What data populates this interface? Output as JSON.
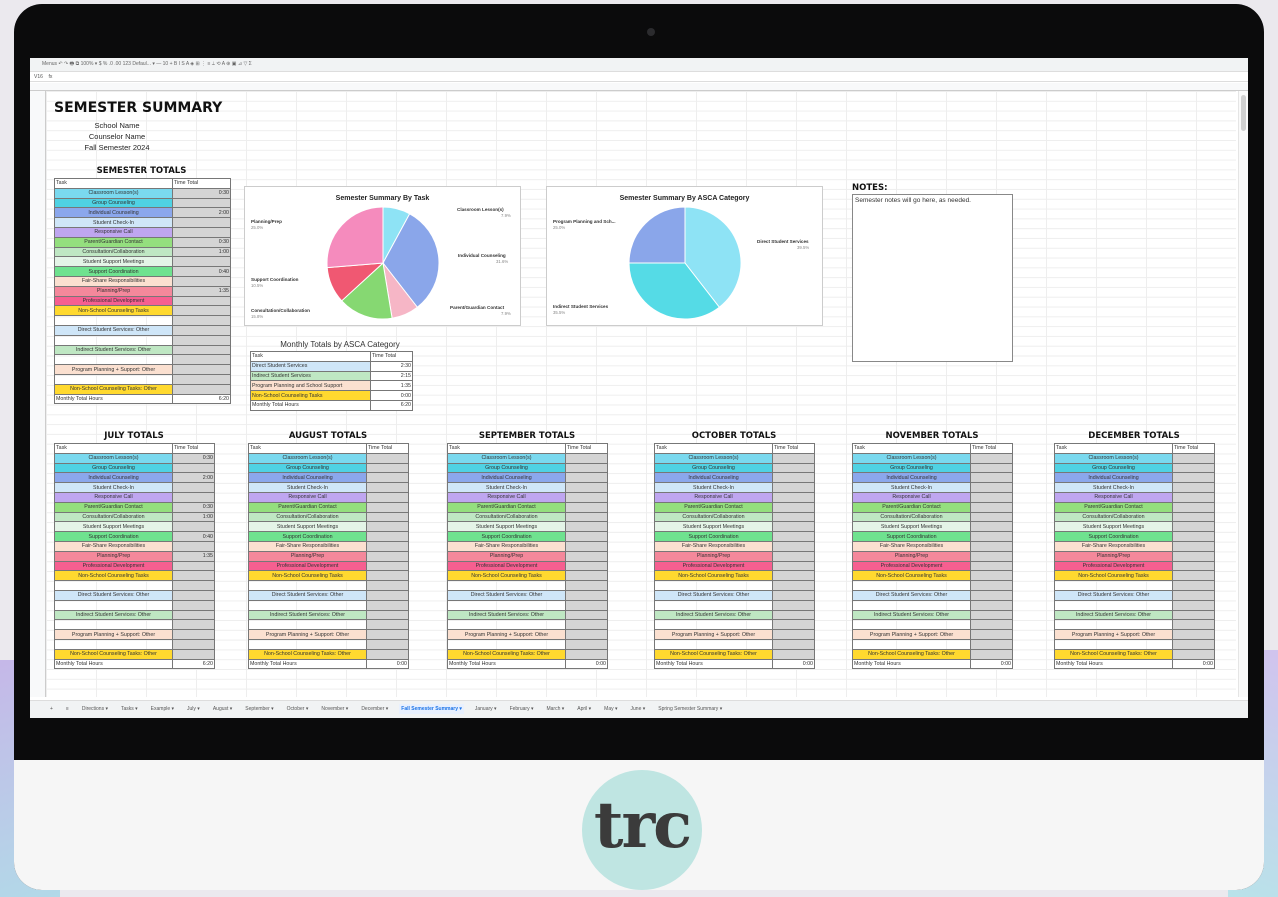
{
  "colors": {
    "cyan": "#7ad9ef",
    "teal": "#4fd2e3",
    "blue": "#8ba7ec",
    "light_blue": "#cfe6f8",
    "purple": "#bfa6f0",
    "green": "#94df7e",
    "light_green": "#bfe7c3",
    "mint": "#e4f4e7",
    "lime": "#6fe28f",
    "peach": "#fbe0d0",
    "salmon": "#f4889b",
    "pink": "#f65f90",
    "yellow": "#ffd92f",
    "cell_gray": "#d4d4d4"
  },
  "logo": {
    "text": "trc"
  },
  "toolbar": {
    "text": "Menus   ↶  ↷  🖶  ⧉  100%  ▾   $  %  .0  .00  123   Defaul... ▾   —  10  +   B  I  S  A  ◈  ⊞  ⋮   ≡  ⟂  ⟲  A   ⊕  ▣  ⊿  ▽  Σ"
  },
  "formula_bar": {
    "cell_ref": "V16",
    "fx": "fx"
  },
  "header": {
    "title": "SEMESTER SUMMARY",
    "school": "School Name",
    "counselor": "Counselor Name",
    "semester": "Fall Semester 2024"
  },
  "semester_totals": {
    "heading": "SEMESTER TOTALS",
    "col_task": "Task",
    "col_time": "Time Total"
  },
  "tasks": [
    {
      "label": "Classroom Lesson(s)",
      "color": "cyan"
    },
    {
      "label": "Group Counseling",
      "color": "teal"
    },
    {
      "label": "Individual Counseling",
      "color": "blue"
    },
    {
      "label": "Student Check-In",
      "color": "light_blue"
    },
    {
      "label": "Responsive Call",
      "color": "purple"
    },
    {
      "label": "Parent/Guardian Contact",
      "color": "green"
    },
    {
      "label": "Consultation/Collaboration",
      "color": "light_green"
    },
    {
      "label": "Student Support Meetings",
      "color": "mint"
    },
    {
      "label": "Support Coordination",
      "color": "lime"
    },
    {
      "label": "Fair-Share Responsibilities",
      "color": "peach"
    },
    {
      "label": "Planning/Prep",
      "color": "salmon"
    },
    {
      "label": "Professional Development",
      "color": "pink"
    },
    {
      "label": "Non-School Counseling Tasks",
      "color": "yellow"
    }
  ],
  "others": [
    {
      "label": "Direct Student Services: Other",
      "color": "light_blue"
    },
    {
      "label": "Indirect Student Services: Other",
      "color": "light_green"
    },
    {
      "label": "Program Planning + Support: Other",
      "color": "peach"
    },
    {
      "label": "Non-School Counseling Tasks: Other",
      "color": "yellow"
    }
  ],
  "monthly_total_label": "Monthly Total Hours",
  "semester_values": [
    "0:30",
    "",
    "2:00",
    "",
    "",
    "0:30",
    "1:00",
    "",
    "0:40",
    "",
    "1:35",
    "",
    "",
    "",
    "",
    "",
    "",
    ""
  ],
  "semester_total": "6:20",
  "notes": {
    "heading": "NOTES:",
    "text": "Semester notes will go here, as needed."
  },
  "asca_table": {
    "title": "Monthly Totals by ASCA Category",
    "col_task": "Task",
    "col_time": "Time Total",
    "rows": [
      {
        "label": "Direct Student Services",
        "value": "2:30",
        "color": "light_blue"
      },
      {
        "label": "Indirect Student Services",
        "value": "2:15",
        "color": "light_green"
      },
      {
        "label": "Program Planning and School Support",
        "value": "1:35",
        "color": "peach"
      },
      {
        "label": "Non-School Counseling Tasks",
        "value": "0:00",
        "color": "yellow"
      },
      {
        "label": "Monthly Total Hours",
        "value": "6:20",
        "color": "white"
      }
    ]
  },
  "chart_data": [
    {
      "type": "pie",
      "title": "Semester Summary By Task",
      "slices": [
        {
          "label": "Classroom Lesson(s)",
          "pct": "7.9%",
          "value": 7.9,
          "color": "#8ee3f5"
        },
        {
          "label": "Individual Counseling",
          "pct": "31.6%",
          "value": 31.6,
          "color": "#8aa6ea"
        },
        {
          "label": "Parent/Guardian Contact",
          "pct": "7.9%",
          "value": 7.9,
          "color": "#f6b6c6"
        },
        {
          "label": "",
          "value": 15.8,
          "color": "#86d872"
        },
        {
          "label": "Support Coordination",
          "pct": "10.5%",
          "value": 10.5,
          "color": "#f05872"
        },
        {
          "label": "Planning/Prep",
          "pct": "25.0%",
          "value": 26.3,
          "color": "#f58bbd"
        }
      ],
      "extra_labels": [
        {
          "label": "Consultation/Collaboration",
          "pct": "15.8%"
        }
      ]
    },
    {
      "type": "pie",
      "title": "Semester Summary By ASCA Category",
      "slices": [
        {
          "label": "Direct Student Services",
          "pct": "39.5%",
          "value": 39.5,
          "color": "#8ee3f5"
        },
        {
          "label": "Indirect Student Services",
          "pct": "35.5%",
          "value": 35.5,
          "color": "#55dbe6"
        },
        {
          "label": "Program Planning and Sch...",
          "pct": "25.0%",
          "value": 25.0,
          "color": "#8aa6ea"
        }
      ]
    }
  ],
  "months": [
    {
      "title": "JULY TOTALS",
      "values": [
        "0:30",
        "",
        "2:00",
        "",
        "",
        "0:30",
        "1:00",
        "",
        "0:40",
        "",
        "1:35",
        "",
        "",
        "",
        "",
        "",
        "",
        ""
      ],
      "total": "6:20"
    },
    {
      "title": "AUGUST TOTALS",
      "values": [],
      "total": "0:00"
    },
    {
      "title": "SEPTEMBER TOTALS",
      "values": [],
      "total": "0:00"
    },
    {
      "title": "OCTOBER TOTALS",
      "values": [],
      "total": "0:00"
    },
    {
      "title": "NOVEMBER TOTALS",
      "values": [],
      "total": "0:00"
    },
    {
      "title": "DECEMBER TOTALS",
      "values": [],
      "total": "0:00"
    }
  ],
  "tabs": [
    "+",
    "≡",
    "Directions ▾",
    "Tasks ▾",
    "Example ▾",
    "July ▾",
    "August ▾",
    "September ▾",
    "October ▾",
    "November ▾",
    "December ▾",
    "Fall Semester Summary ▾",
    "January ▾",
    "February ▾",
    "March ▾",
    "April ▾",
    "May ▾",
    "June ▾",
    "Spring Semester Summary ▾"
  ],
  "active_tab": 11
}
